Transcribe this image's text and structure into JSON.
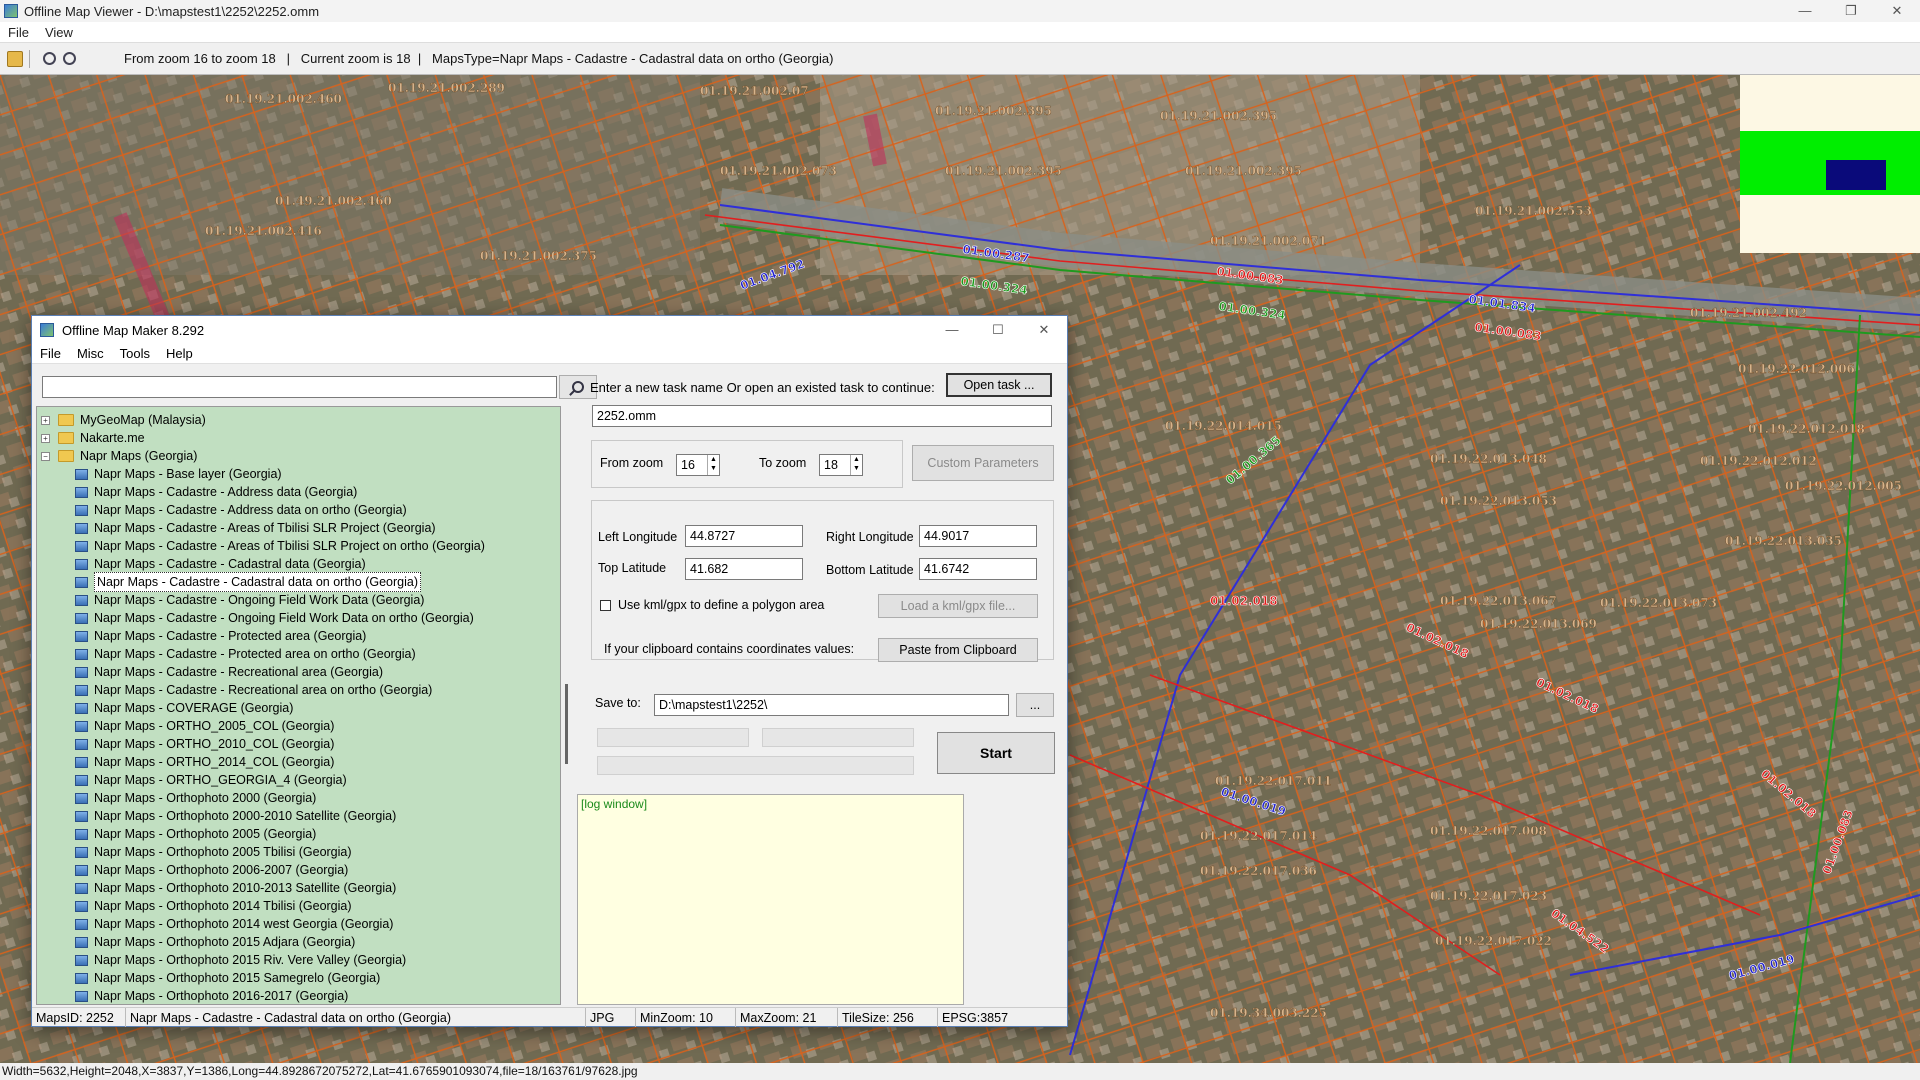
{
  "window": {
    "title": "Offline Map Viewer - D:\\mapstest1\\2252\\2252.omm"
  },
  "menubar": {
    "file": "File",
    "view": "View"
  },
  "toolbar": {
    "info": "From zoom 16 to zoom 18   |   Current zoom is 18  |   MapsType=Napr Maps - Cadastre - Cadastral data on ortho (Georgia)"
  },
  "map_labels": [
    "01.19.21.002.289",
    "01.19.21.002.07",
    "01.19.21.002.395",
    "01.19.21.002.395",
    "01.19.21.002.460",
    "01.19.21.002.073",
    "01.19.21.002.395",
    "01.19.21.002.395",
    "01.49.21.002.460",
    "01.19.21.002.553",
    "01.19.21.002.416",
    "01.19.21.002.071",
    "01.19.21.002.375",
    "01.19.21.002.492",
    "01.19.22.012.006",
    "01.19.22.014.015",
    "01.19.22.012.018",
    "01.19.22.013.048",
    "01.19.22.012.012",
    "01.19.22.012.005",
    "01.19.22.013.053",
    "01.19.22.013.035",
    "01.19.22.013.067",
    "01.19.22.013.073",
    "01.19.22.013.069",
    "01.19.22.017.011",
    "01.19.22.017.008",
    "01.19.22.017.014",
    "01.19.22.017.036",
    "01.19.22.017.023",
    "01.19.22.017.022",
    "01.19.34.003.225"
  ],
  "road_labels_blue": [
    "01.00.287",
    "01.01.834",
    "01.00.019",
    "01.00.019",
    "01.04.792"
  ],
  "road_labels_red": [
    "01.00.083",
    "01.00.083",
    "01.02.018",
    "01.02.018",
    "01.02.018",
    "01.02.018",
    "01.04.522",
    "01.00.083"
  ],
  "road_labels_green": [
    "01.00.324",
    "01.00.324",
    "01.00.365"
  ],
  "statusbar": {
    "text": "Width=5632,Height=2048,X=3837,Y=1386,Long=44.8928672075272,Lat=41.6765901093074,file=18/163761/97628.jpg"
  },
  "dialog": {
    "title": "Offline Map Maker 8.292",
    "menu": {
      "file": "File",
      "misc": "Misc",
      "tools": "Tools",
      "help": "Help"
    },
    "search": {
      "value": "",
      "placeholder": ""
    },
    "tree": {
      "folders": [
        {
          "label": "MyGeoMap (Malaysia)",
          "expanded": false
        },
        {
          "label": "Nakarte.me",
          "expanded": false
        },
        {
          "label": "Napr Maps (Georgia)",
          "expanded": true
        }
      ],
      "items": [
        "Napr Maps - Base layer (Georgia)",
        "Napr Maps - Cadastre - Address data (Georgia)",
        "Napr Maps - Cadastre - Address data on ortho (Georgia)",
        "Napr Maps - Cadastre - Areas of Tbilisi SLR Project (Georgia)",
        "Napr Maps - Cadastre - Areas of Tbilisi SLR Project on ortho (Georgia)",
        "Napr Maps - Cadastre - Cadastral data (Georgia)",
        "Napr Maps - Cadastre - Cadastral data on ortho (Georgia)",
        "Napr Maps - Cadastre - Ongoing Field Work Data (Georgia)",
        "Napr Maps - Cadastre - Ongoing Field Work Data on ortho (Georgia)",
        "Napr Maps - Cadastre - Protected area (Georgia)",
        "Napr Maps - Cadastre - Protected area on ortho (Georgia)",
        "Napr Maps - Cadastre - Recreational area (Georgia)",
        "Napr Maps - Cadastre - Recreational area on ortho (Georgia)",
        "Napr Maps - COVERAGE (Georgia)",
        "Napr Maps - ORTHO_2005_COL (Georgia)",
        "Napr Maps - ORTHO_2010_COL (Georgia)",
        "Napr Maps - ORTHO_2014_COL (Georgia)",
        "Napr Maps - ORTHO_GEORGIA_4 (Georgia)",
        "Napr Maps - Orthophoto 2000 (Georgia)",
        "Napr Maps - Orthophoto 2000-2010 Satellite (Georgia)",
        "Napr Maps - Orthophoto 2005 (Georgia)",
        "Napr Maps - Orthophoto 2005 Tbilisi (Georgia)",
        "Napr Maps - Orthophoto 2006-2007 (Georgia)",
        "Napr Maps - Orthophoto 2010-2013 Satellite (Georgia)",
        "Napr Maps - Orthophoto 2014 Tbilisi (Georgia)",
        "Napr Maps - Orthophoto 2014 west Georgia (Georgia)",
        "Napr Maps - Orthophoto 2015 Adjara (Georgia)",
        "Napr Maps - Orthophoto 2015 Riv. Vere Valley (Georgia)",
        "Napr Maps - Orthophoto 2015 Samegrelo (Georgia)",
        "Napr Maps - Orthophoto 2016-2017 (Georgia)"
      ],
      "selected_index": 6
    },
    "task_prompt": "Enter a new task name Or open an existed task to continue:",
    "open_task_label": "Open task ...",
    "task_name": "2252.omm",
    "from_zoom_label": "From zoom",
    "from_zoom": "16",
    "to_zoom_label": "To zoom",
    "to_zoom": "18",
    "custom_params_label": "Custom Parameters",
    "left_lon_label": "Left Longitude",
    "left_lon": "44.8727",
    "right_lon_label": "Right Longitude",
    "right_lon": "44.9017",
    "top_lat_label": "Top Latitude",
    "top_lat": "41.682",
    "bottom_lat_label": "Bottom Latitude",
    "bottom_lat": "41.6742",
    "kml_label": "Use kml/gpx to define a polygon area",
    "load_kml_label": "Load a kml/gpx file...",
    "clipboard_label": "If your clipboard contains coordinates values:",
    "paste_label": "Paste from Clipboard",
    "save_to_label": "Save to:",
    "save_to": "D:\\mapstest1\\2252\\",
    "browse_label": "...",
    "start_label": "Start",
    "log_text": "[log window]",
    "status": {
      "maps_id": "MapsID: 2252",
      "maps_name": "Napr Maps - Cadastre - Cadastral data on ortho (Georgia)",
      "format": "JPG",
      "min_zoom": "MinZoom: 10",
      "max_zoom": "MaxZoom: 21",
      "tile_size": "TileSize: 256",
      "epsg": "EPSG:3857"
    }
  }
}
